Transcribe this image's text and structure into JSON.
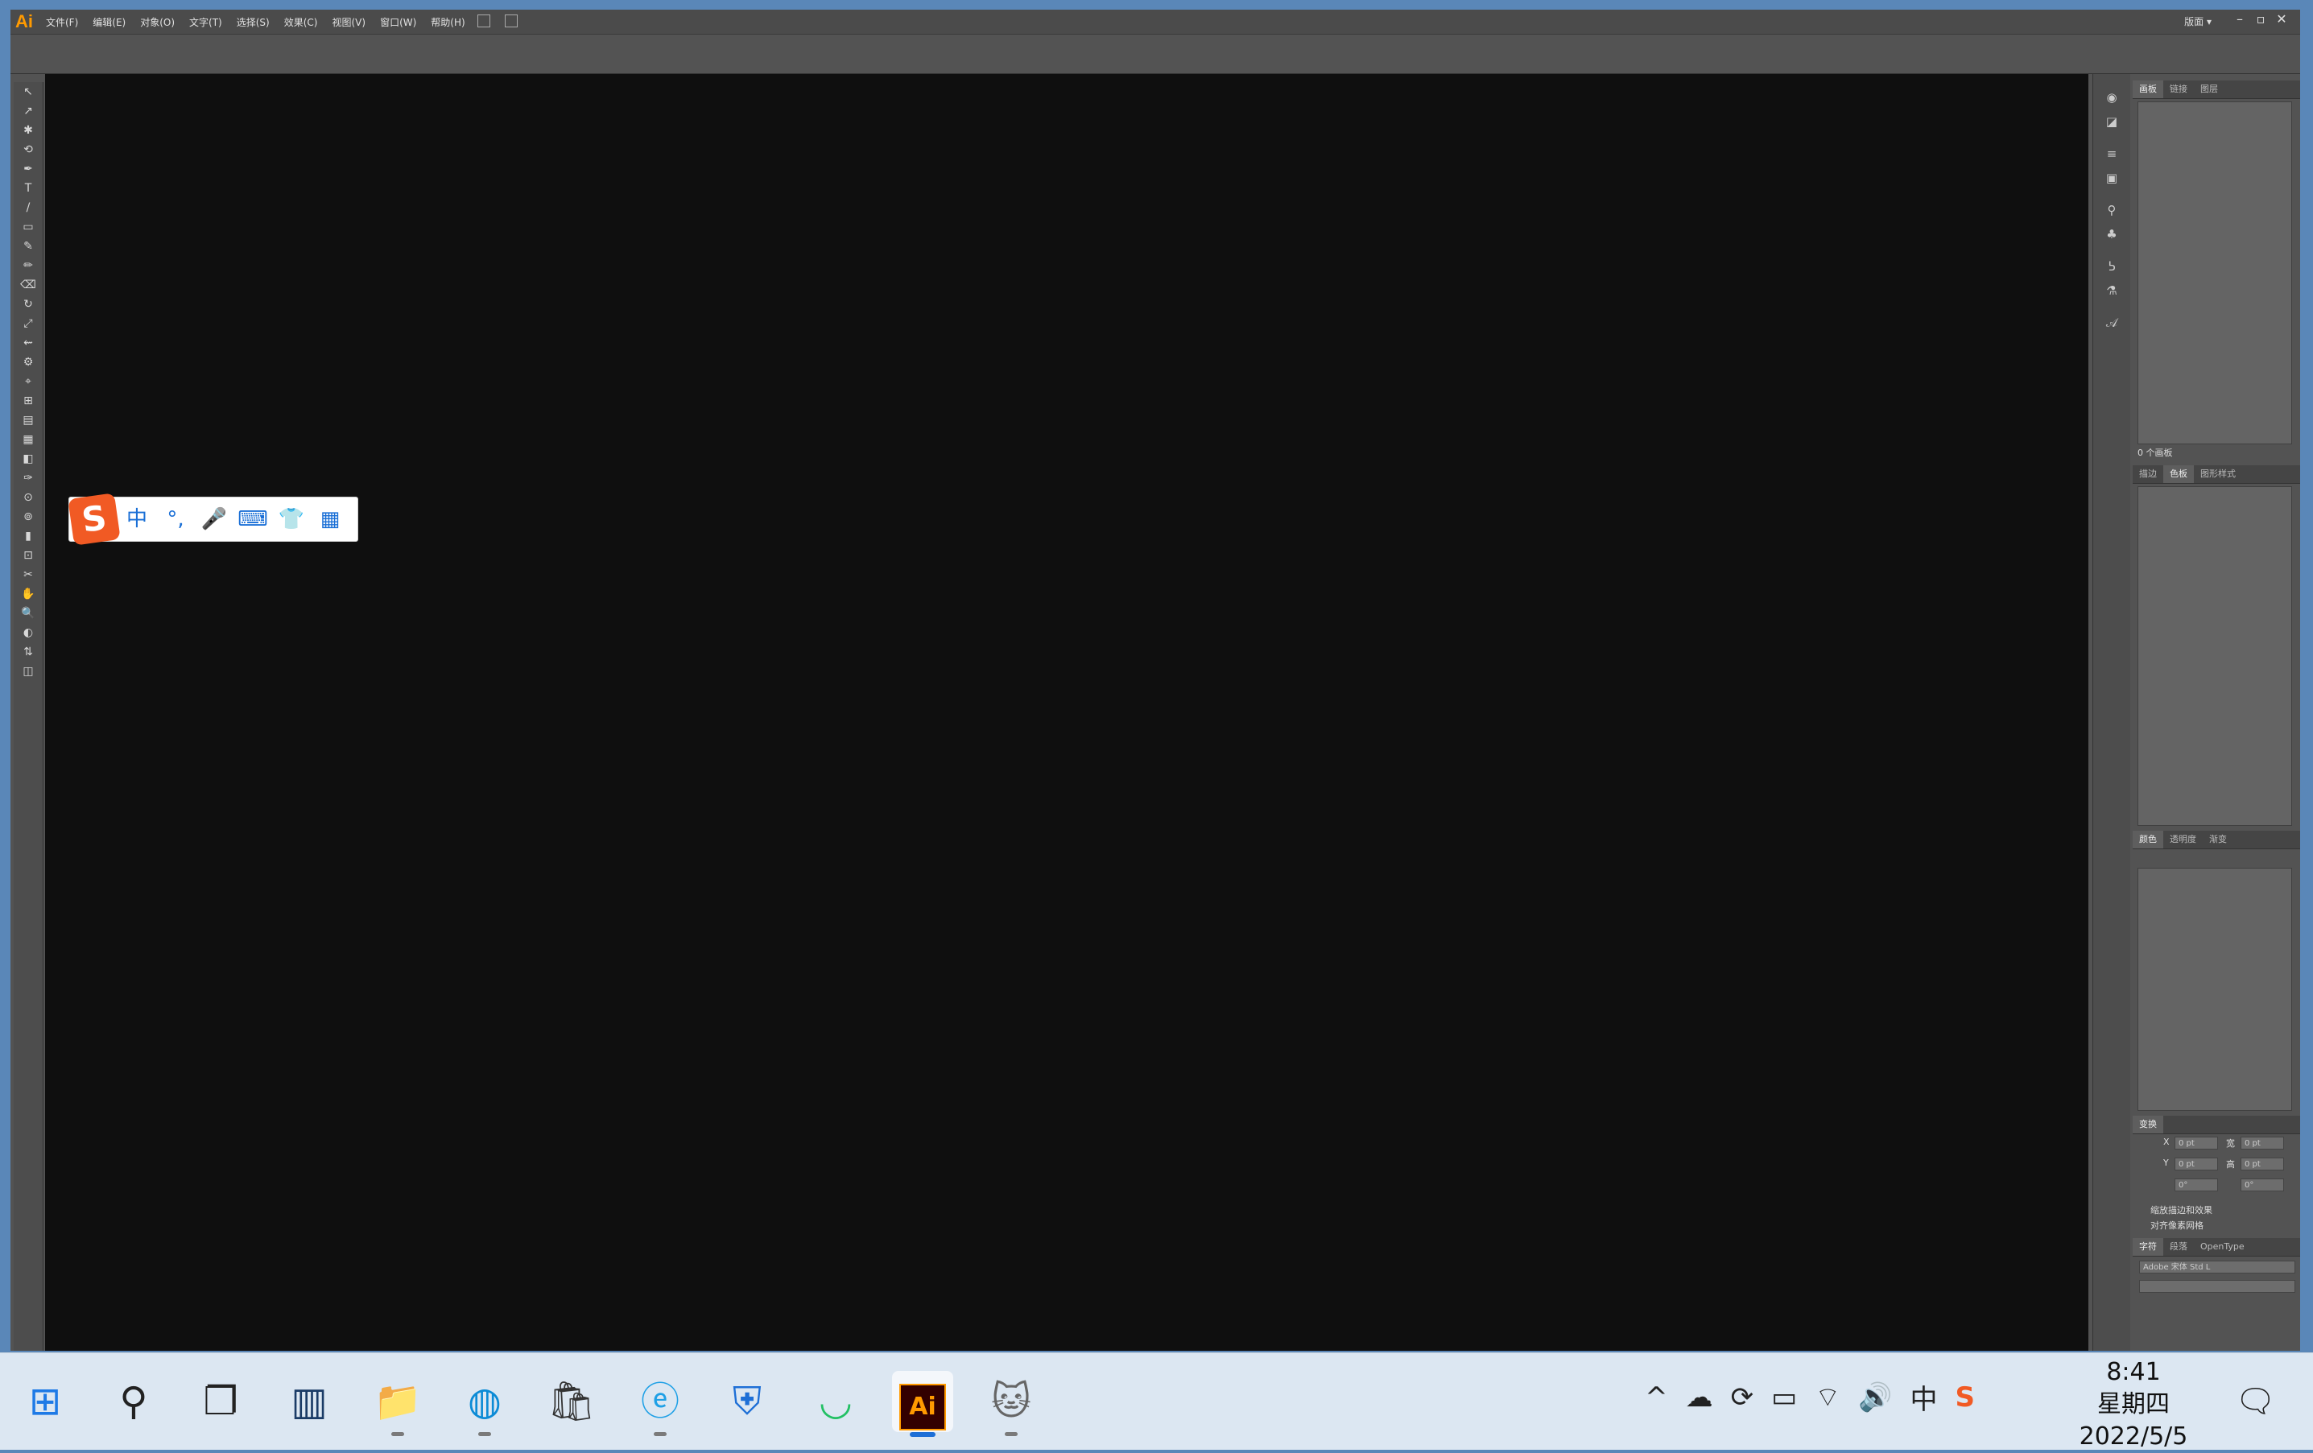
{
  "app": {
    "logo": "Ai",
    "menu": [
      "文件(F)",
      "编辑(E)",
      "对象(O)",
      "文字(T)",
      "选择(S)",
      "效果(C)",
      "视图(V)",
      "窗口(W)",
      "帮助(H)"
    ],
    "workspace_label": "版面 ▾",
    "window_controls": [
      "–",
      "▫",
      "✕"
    ]
  },
  "toolbar": {
    "tools": [
      "↖",
      "↗",
      "✱",
      "⟲",
      "✒",
      "T",
      "/",
      "▭",
      "✎",
      "✏",
      "⌫",
      "↻",
      "⤢",
      "⇜",
      "⚙",
      "⌖",
      "⊞",
      "▤",
      "▦",
      "◧",
      "✑",
      "⊙",
      "⊚",
      "▮",
      "⊡",
      "✂",
      "✋",
      "🔍",
      "◐",
      "⇅",
      "◫"
    ]
  },
  "icon_strip": [
    "◉",
    "◪",
    "≡",
    "▣",
    "⚲",
    "♣",
    "ᕊ",
    "⚗",
    "𝒜"
  ],
  "panels": {
    "artboard": {
      "tabs": [
        "画板",
        "链接",
        "图层"
      ],
      "footer": "0 个画板"
    },
    "swatches": {
      "tabs": [
        "描边",
        "色板",
        "图形样式"
      ]
    },
    "color": {
      "tabs": [
        "颜色",
        "透明度",
        "渐变"
      ]
    },
    "transform": {
      "tabs": [
        "变换"
      ],
      "x_label": "X",
      "x_value": "0 pt",
      "w_label": "宽",
      "w_value": "0 pt",
      "y_label": "Y",
      "y_value": "0 pt",
      "h_label": "高",
      "h_value": "0 pt",
      "rot_value": "0°",
      "shear_value": "0°",
      "opt1": "缩放描边和效果",
      "opt2": "对齐像素网格"
    },
    "character": {
      "tabs": [
        "字符",
        "段落",
        "OpenType"
      ],
      "font": "Adobe 宋体 Std L"
    }
  },
  "ime": {
    "logo": "S",
    "buttons": [
      "中",
      "°,",
      "🎤",
      "⌨",
      "👕",
      "▦"
    ]
  },
  "taskbar": {
    "apps": [
      {
        "name": "start",
        "glyph": "⊞",
        "color": "#1e7ae6"
      },
      {
        "name": "search",
        "glyph": "⚲",
        "color": "#222"
      },
      {
        "name": "task-view",
        "glyph": "❐",
        "color": "#222"
      },
      {
        "name": "widgets",
        "glyph": "▥",
        "color": "#1a3b66"
      },
      {
        "name": "file-explorer",
        "glyph": "📁",
        "color": "#e8b62a"
      },
      {
        "name": "edge",
        "glyph": "◍",
        "color": "#0c8bd6"
      },
      {
        "name": "store",
        "glyph": "🛍",
        "color": "#333"
      },
      {
        "name": "ie-browser",
        "glyph": "ⓔ",
        "color": "#1ea0e6"
      },
      {
        "name": "security-app",
        "glyph": "⛨",
        "color": "#1e6fd6"
      },
      {
        "name": "shopping-app",
        "glyph": "◡",
        "color": "#22c064"
      },
      {
        "name": "illustrator",
        "glyph": "Ai",
        "color": "#ff9a00"
      },
      {
        "name": "game-app",
        "glyph": "🐱",
        "color": "#666"
      }
    ],
    "tray": [
      "^",
      "☁",
      "⟳",
      "▭",
      "⌔",
      "🔊",
      "中",
      "S"
    ],
    "time": "8:41",
    "weekday": "星期四",
    "date": "2022/5/5",
    "notification_icon": "🗨"
  }
}
